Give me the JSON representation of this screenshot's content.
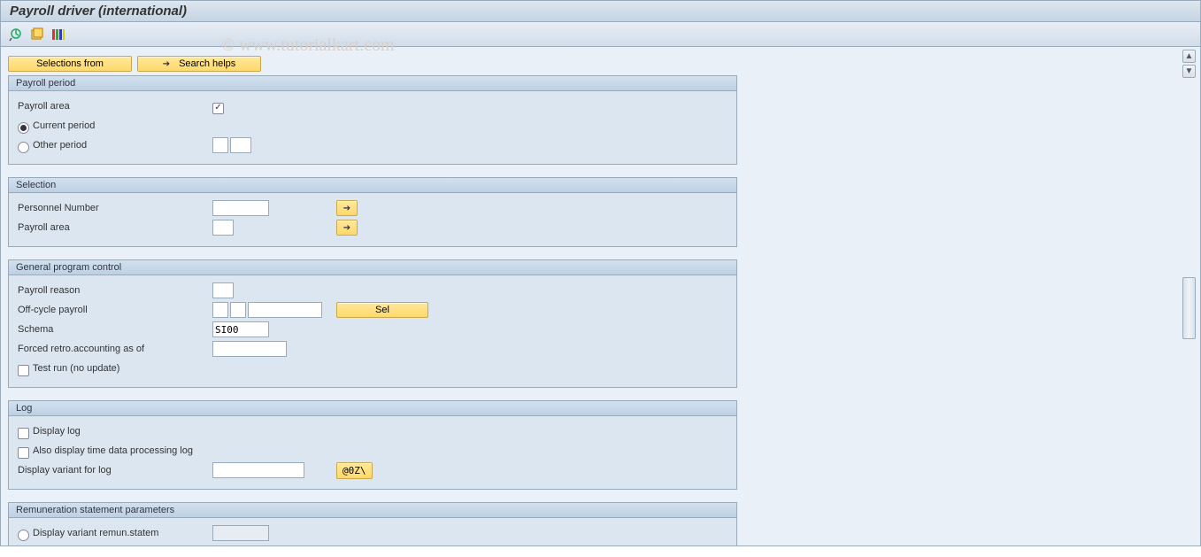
{
  "title": "Payroll driver (international)",
  "watermark": "© www.tutorialkart.com",
  "top_buttons": {
    "selections_from": "Selections from",
    "search_helps": "Search helps"
  },
  "groups": {
    "payroll_period": {
      "header": "Payroll period",
      "payroll_area_label": "Payroll area",
      "current_period_label": "Current period",
      "other_period_label": "Other period"
    },
    "selection": {
      "header": "Selection",
      "personnel_number_label": "Personnel Number",
      "payroll_area_label": "Payroll area"
    },
    "general": {
      "header": "General program control",
      "payroll_reason_label": "Payroll reason",
      "off_cycle_label": "Off-cycle payroll",
      "sel_button": "Sel",
      "schema_label": "Schema",
      "schema_value": "SI00",
      "forced_retro_label": "Forced retro.accounting as of",
      "test_run_label": "Test run (no update)"
    },
    "log": {
      "header": "Log",
      "display_log_label": "Display log",
      "also_display_label": "Also display time data processing log",
      "display_variant_label": "Display variant for log",
      "variant_button": "@0Z\\"
    },
    "remun": {
      "header": "Remuneration statement parameters",
      "display_variant_remun_label": "Display variant remun.statem"
    }
  }
}
